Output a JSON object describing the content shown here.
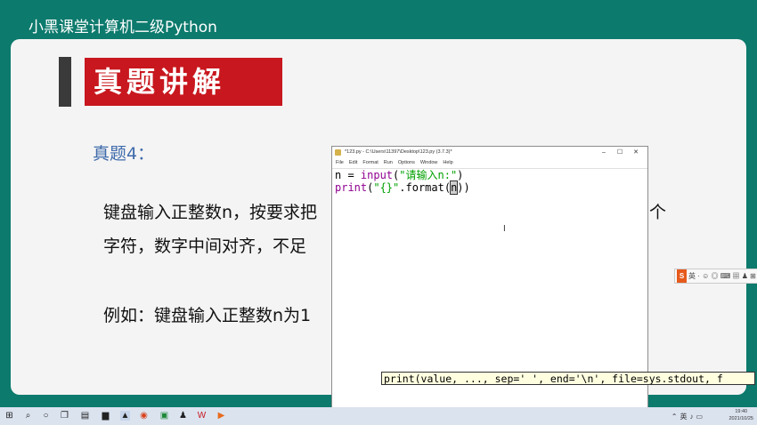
{
  "course_title": "小黑课堂计算机二级Python",
  "slide": {
    "banner": "真题讲解",
    "question_label": "真题4：",
    "line1": "键盘输入正整数n，按要求把",
    "line1_tail": "个",
    "line2": "字符，数字中间对齐，不足",
    "line3": "例如：键盘输入正整数n为1"
  },
  "editor": {
    "title": "*123.py - C:\\Users\\11397\\Desktop\\123.py (3.7.3)*",
    "controls": {
      "minimize": "–",
      "maximize": "☐",
      "close": "✕"
    },
    "menu": [
      "File",
      "Edit",
      "Format",
      "Run",
      "Options",
      "Window",
      "Help"
    ],
    "code": {
      "l1_a": "n = ",
      "l1_kw": "input",
      "l1_b": "(",
      "l1_str": "\"请输入n:\"",
      "l1_c": ")",
      "l2_kw": "print",
      "l2_b": "(",
      "l2_str": "\"{}\"",
      "l2_c": ".format(",
      "l2_cursor": "n",
      "l2_d": "))"
    },
    "ibeam": "I",
    "calltip": "print(value, ..., sep=' ', end='\\n', file=sys.stdout, f"
  },
  "ime_bar": "英 · ☺ ◎ ⌨ ▦ ♟ ⊞ ⁝",
  "taskbar": {
    "icons": [
      "windows-start",
      "search",
      "cortana",
      "task-view",
      "chat",
      "explorer",
      "idle",
      "chrome",
      "photo",
      "person",
      "wps",
      "media"
    ],
    "time": "19:40",
    "date": "2021/10/25",
    "lang": "英"
  },
  "colors": {
    "background": "#0c7a6d",
    "banner_red": "#c8171e",
    "question_blue": "#3f6bab",
    "keyword": "#900090",
    "string": "#00a000"
  }
}
